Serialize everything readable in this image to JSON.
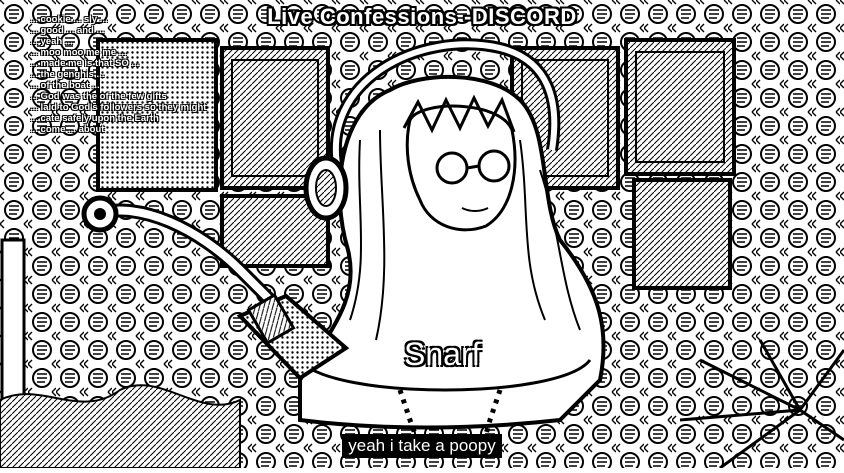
{
  "stream": {
    "title": "Live Confessions -DISCORD",
    "nameplate": "Snarf",
    "caption": "yeah i take a poopy"
  },
  "chat": {
    "lines": [
      "... cookie ... sly ...",
      "... good ... and ...",
      "... yeah ...",
      "... moo moo me me ...",
      "... made me is that SO ...",
      "... the genghis ...",
      "... of the boat ...",
      "... God was the of the few gifts",
      "... laid to God's followers so they might",
      "... cate safely upon the Earth",
      "... come ... about"
    ]
  },
  "colors": {
    "background": "#ffffff",
    "ink": "#000000",
    "caption_bg": "#000000",
    "caption_text": "#ffffff"
  }
}
